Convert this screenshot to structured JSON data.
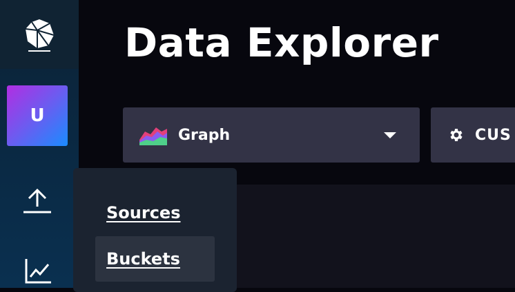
{
  "nav": {
    "logo_icon": "influxdb-cube-logo",
    "avatar_initial": "U",
    "items": [
      {
        "name": "upload",
        "icon": "upload-icon"
      },
      {
        "name": "data-explorer",
        "icon": "graph-icon"
      }
    ],
    "submenu": {
      "items": [
        {
          "label": "Sources"
        },
        {
          "label": "Buckets",
          "active": true
        }
      ]
    }
  },
  "header": {
    "title": "Data Explorer"
  },
  "toolbar": {
    "visualization_type": "Graph",
    "visualization_icon": "graph-area-icon",
    "customize_label": "CUS",
    "customize_icon": "gear-icon"
  },
  "colors": {
    "avatar_gradient": [
      "#b12ee2",
      "#6b5cf0",
      "#1a8cff"
    ],
    "dropdown_bg": "#333346",
    "nav_bg": "#0c2236"
  }
}
